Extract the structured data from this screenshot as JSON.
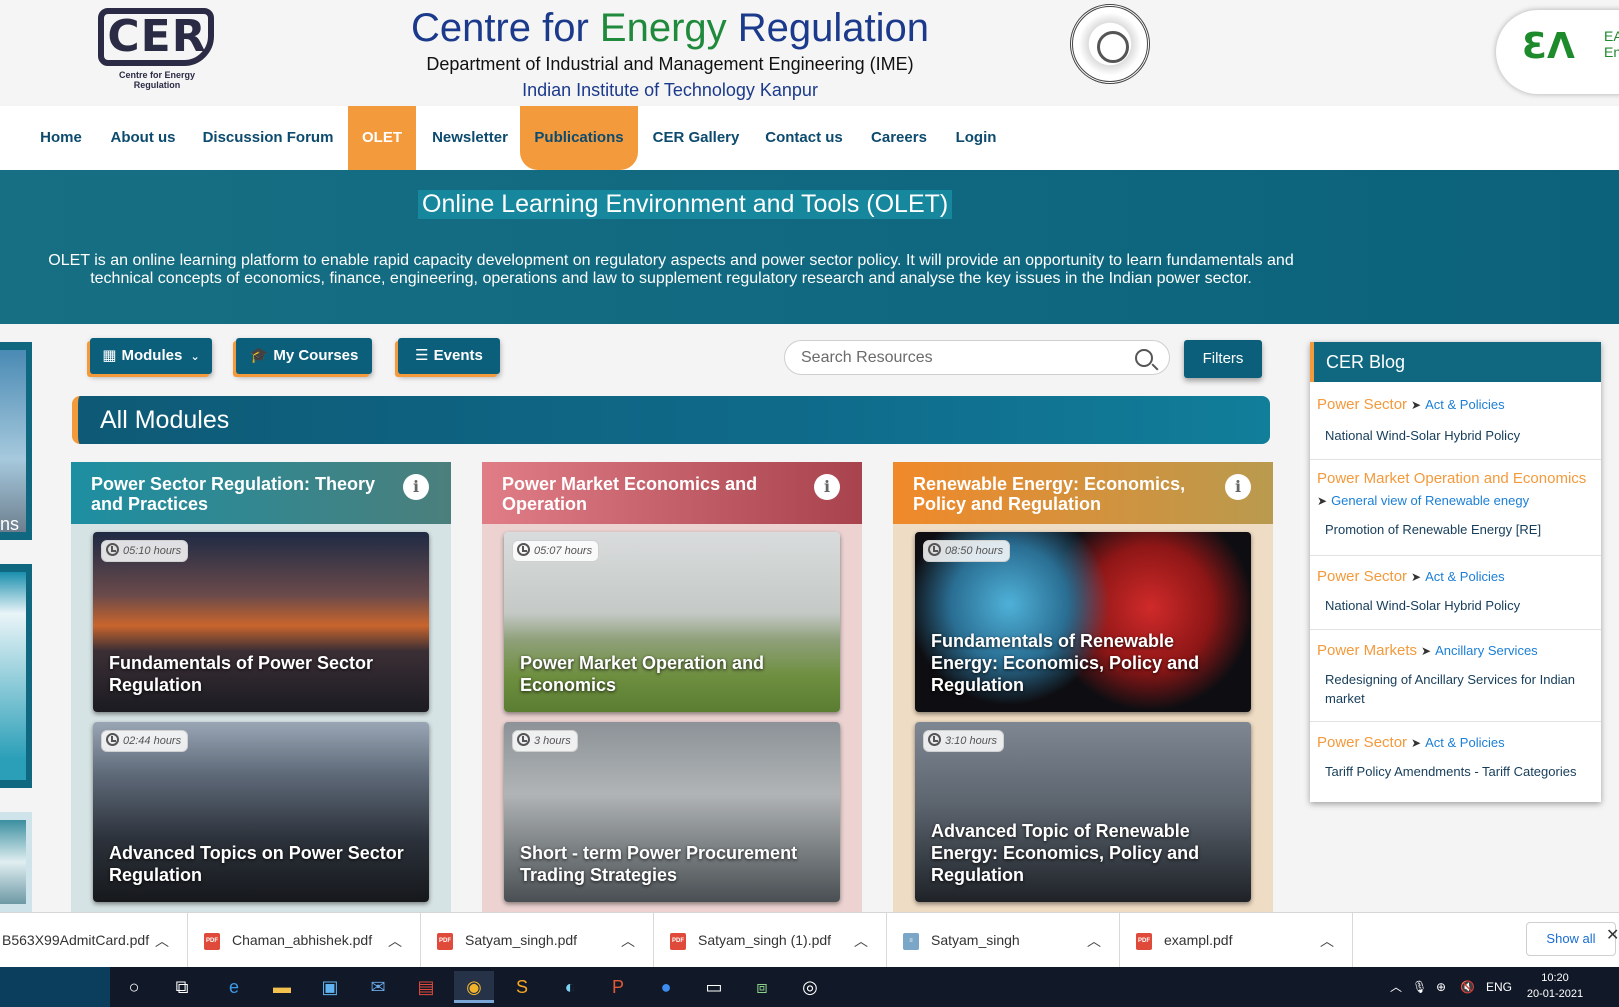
{
  "header": {
    "logo_text": "CER",
    "logo_sub": "Centre for Energy Regulation",
    "title_part1": "Centre for",
    "title_part2": "Energy",
    "title_part3": "Regulation",
    "department": "Department of Industrial and Management Engineering (IME)",
    "institute": "Indian Institute of Technology Kanpur",
    "eal_text": "EA\nEn"
  },
  "nav": {
    "items": [
      "Home",
      "About us",
      "Discussion Forum",
      "OLET",
      "Newsletter",
      "Publications",
      "CER Gallery",
      "Contact us",
      "Careers",
      "Login"
    ],
    "active": "OLET"
  },
  "banner": {
    "title": "Online Learning Environment and Tools (OLET)",
    "text": "OLET is an online learning platform to enable rapid capacity development on regulatory aspects and power sector policy. It will provide an opportunity to learn fundamentals and technical concepts of economics, finance, engineering, operations and law to supplement regulatory research and analyse the key issues in the Indian power sector."
  },
  "toolbar": {
    "modules_label": "Modules",
    "courses_label": "My Courses",
    "events_label": "Events",
    "search_placeholder": "Search Resources",
    "filters_label": "Filters"
  },
  "all_modules_label": "All Modules",
  "modules": [
    {
      "title": "Power Sector Regulation: Theory and Practices",
      "courses": [
        {
          "hours": "05:10 hours",
          "title": "Fundamentals of Power Sector Regulation"
        },
        {
          "hours": "02:44 hours",
          "title": "Advanced Topics on Power Sector Regulation"
        }
      ]
    },
    {
      "title": "Power Market Economics and Operation",
      "courses": [
        {
          "hours": "05:07 hours",
          "title": "Power Market Operation and Economics"
        },
        {
          "hours": "3 hours",
          "title": "Short - term Power Procurement Trading Strategies"
        }
      ]
    },
    {
      "title": "Renewable Energy: Economics, Policy and Regulation",
      "courses": [
        {
          "hours": "08:50 hours",
          "title": "Fundamentals of Renewable Energy: Economics, Policy and Regulation"
        },
        {
          "hours": "3:10 hours",
          "title": "Advanced Topic of Renewable Energy: Economics, Policy and Regulation"
        }
      ]
    }
  ],
  "blog": {
    "title": "CER Blog",
    "items": [
      {
        "category": "Power Sector",
        "sub": "Act & Policies",
        "title": "National Wind-Solar Hybrid Policy"
      },
      {
        "category": "Power Market Operation and Economics",
        "sub": "General view of Renewable enegy",
        "title": "Promotion of Renewable Energy [RE]"
      },
      {
        "category": "Power Sector",
        "sub": "Act & Policies",
        "title": "National Wind-Solar Hybrid Policy"
      },
      {
        "category": "Power Markets",
        "sub": "Ancillary Services",
        "title": "Redesigning of Ancillary Services for Indian market"
      },
      {
        "category": "Power Sector",
        "sub": "Act & Policies",
        "title": "Tariff Policy Amendments - Tariff Categories"
      }
    ]
  },
  "left_panel_text": "ns",
  "downloads": {
    "files": [
      "B563X99AdmitCard.pdf",
      "Chaman_abhishek.pdf",
      "Satyam_singh.pdf",
      "Satyam_singh (1).pdf",
      "Satyam_singh",
      "exampl.pdf"
    ],
    "show_all": "Show all"
  },
  "taskbar": {
    "lang": "ENG",
    "time": "10:20",
    "date": "20-01-2021"
  },
  "colors": {
    "accent_orange": "#f39a3c",
    "teal_dark": "#0f6880",
    "nav_text": "#0c4a6e"
  }
}
